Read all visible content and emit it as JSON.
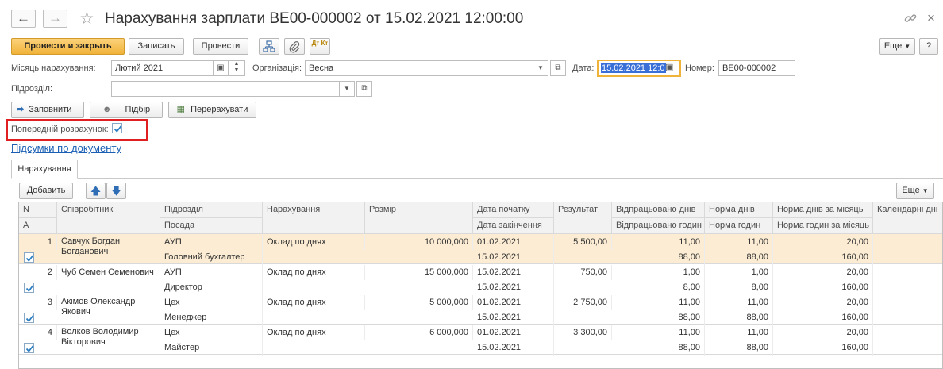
{
  "window": {
    "title": "Нарахування зарплати ВЕ00-000002 от 15.02.2021 12:00:00",
    "help_label": "?"
  },
  "toolbar": {
    "post_close_label": "Провести и закрыть",
    "save_label": "Записать",
    "post_label": "Провести",
    "dtkt_label": "Дт Кт",
    "more_label": "Еще"
  },
  "form": {
    "month_label": "Місяць нарахування:",
    "month_value": "Лютий 2021",
    "org_label": "Організація:",
    "org_value": "Весна",
    "date_label": "Дата:",
    "date_value": "15.02.2021 12:0",
    "number_label": "Номер:",
    "number_value": "ВЕ00-000002",
    "dept_label": "Підрозділ:",
    "dept_value": ""
  },
  "actions": {
    "fill_label": "Заповнити",
    "select_label": "Підбір",
    "recalc_label": "Перерахувати"
  },
  "preliminary": {
    "label": "Попередній розрахунок:",
    "checked": true
  },
  "totals_link": "Підсумки по документу",
  "tabs": [
    {
      "label": "Нарахування"
    }
  ],
  "table_toolbar": {
    "add_label": "Добавить",
    "more_label": "Еще"
  },
  "table": {
    "headers_top": [
      "N",
      "Співробітник",
      "Підрозділ",
      "Нарахування",
      "Розмір",
      "Дата початку",
      "Результат",
      "Відпрацьовано днів",
      "Норма днів",
      "Норма днів за місяць",
      "Календарні дні"
    ],
    "headers_bottom": [
      "А",
      "",
      "Посада",
      "",
      "",
      "Дата закінчення",
      "",
      "Відпрацьовано годин",
      "Норма годин",
      "Норма годин за місяць",
      ""
    ],
    "rows": [
      {
        "n": "1",
        "employee": "Савчук Богдан Богданович",
        "dept": "АУП",
        "position": "Головний бухгалтер",
        "accrual": "Оклад по днях",
        "amount": "10 000,000",
        "start": "01.02.2021",
        "end": "15.02.2021",
        "result": "5 500,00",
        "days": "11,00",
        "hours": "88,00",
        "norm_days": "11,00",
        "norm_hours": "88,00",
        "month_days": "20,00",
        "month_hours": "160,00",
        "checked": true,
        "selected": true
      },
      {
        "n": "2",
        "employee": "Чуб Семен Семенович",
        "dept": "АУП",
        "position": "Директор",
        "accrual": "Оклад по днях",
        "amount": "15 000,000",
        "start": "15.02.2021",
        "end": "15.02.2021",
        "result": "750,00",
        "days": "1,00",
        "hours": "8,00",
        "norm_days": "1,00",
        "norm_hours": "8,00",
        "month_days": "20,00",
        "month_hours": "160,00",
        "checked": true,
        "selected": false
      },
      {
        "n": "3",
        "employee": "Акімов Олександр Якович",
        "dept": "Цех",
        "position": "Менеджер",
        "accrual": "Оклад по днях",
        "amount": "5 000,000",
        "start": "01.02.2021",
        "end": "15.02.2021",
        "result": "2 750,00",
        "days": "11,00",
        "hours": "88,00",
        "norm_days": "11,00",
        "norm_hours": "88,00",
        "month_days": "20,00",
        "month_hours": "160,00",
        "checked": true,
        "selected": false
      },
      {
        "n": "4",
        "employee": "Волков Володимир Вікторович",
        "dept": "Цех",
        "position": "Майстер",
        "accrual": "Оклад по днях",
        "amount": "6 000,000",
        "start": "01.02.2021",
        "end": "15.02.2021",
        "result": "3 300,00",
        "days": "11,00",
        "hours": "88,00",
        "norm_days": "11,00",
        "norm_hours": "88,00",
        "month_days": "20,00",
        "month_hours": "160,00",
        "checked": true,
        "selected": false
      }
    ]
  },
  "colors": {
    "primary_button": "#f0b33a",
    "selected_row": "#fbecd3",
    "highlight_box": "#e02020",
    "link": "#1a5fb4",
    "date_selection": "#3a6fd8"
  }
}
